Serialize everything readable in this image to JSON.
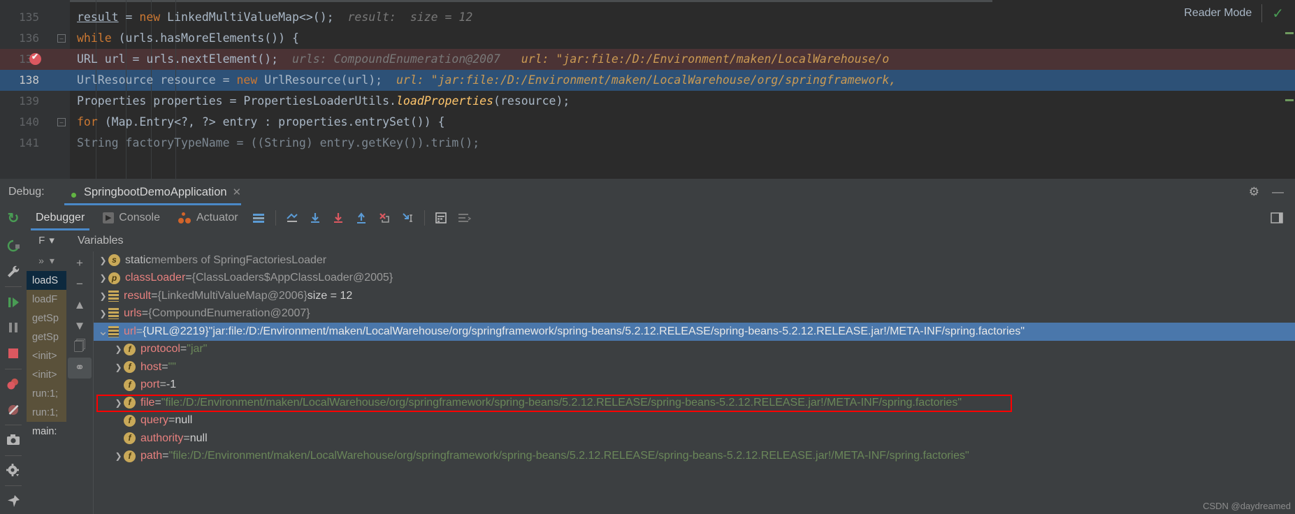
{
  "editor": {
    "reader_mode_label": "Reader Mode",
    "reader_mode_icon": "checkmark-icon",
    "lines": [
      {
        "number": "135",
        "code": "        result = new LinkedMultiValueMap<>();",
        "hint": "result:  size = 12"
      },
      {
        "number": "136",
        "code": "        while (urls.hasMoreElements()) {",
        "hint": ""
      },
      {
        "number": "137",
        "code": "            URL url = urls.nextElement();",
        "hint": "urls: CompoundEnumeration@2007",
        "hint2": "url: \"jar:file:/D:/Environment/maken/LocalWarehouse/o"
      },
      {
        "number": "138",
        "code": "            UrlResource resource = new UrlResource(url);",
        "hint": "url: \"jar:file:/D:/Environment/maken/LocalWarehouse/org/springframework,"
      },
      {
        "number": "139",
        "code": "            Properties properties = PropertiesLoaderUtils.loadProperties(resource);",
        "hint": ""
      },
      {
        "number": "140",
        "code": "            for (Map.Entry<?, ?> entry : properties.entrySet()) {",
        "hint": ""
      },
      {
        "number": "141",
        "code": "                String factoryTypeName = ((String) entry.getKey()).trim();",
        "hint": ""
      }
    ]
  },
  "debug_header": {
    "label": "Debug:",
    "run_config_name": "SpringbootDemoApplication",
    "run_config_icon": "spring-leaf-icon",
    "close_icon": "close-icon",
    "settings_icon": "gear-icon",
    "minimize_icon": "minimize-icon"
  },
  "debug_toolbar": {
    "rerun_icon": "rerun-icon",
    "tabs": [
      {
        "label": "Debugger",
        "icon": "",
        "active": true
      },
      {
        "label": "Console",
        "icon": "console-icon",
        "active": false
      },
      {
        "label": "Actuator",
        "icon": "actuator-icon",
        "active": false
      }
    ],
    "buttons": [
      "layout-settings-icon",
      "show-execution-point-icon",
      "step-over-icon",
      "step-into-icon",
      "step-out-icon",
      "force-step-into-icon",
      "run-to-cursor-icon",
      "evaluate-expression-icon",
      "mute-breakpoints-icon",
      "restore-layout-icon"
    ]
  },
  "left_rail": {
    "buttons": [
      "rerun-debug-icon",
      "settings-wrench-icon",
      "resume-program-icon",
      "pause-program-icon",
      "stop-icon",
      "view-breakpoints-icon",
      "mute-breakpoints-icon",
      "screenshot-icon",
      "settings-gear-icon",
      "pin-icon"
    ]
  },
  "frames": {
    "header_label": "F",
    "header_chevron": "chevron-down-icon",
    "overflow_icon": "double-chevron-icon",
    "thread_chevron": "chevron-down-icon",
    "items": [
      {
        "label": "loadS",
        "state": "selected"
      },
      {
        "label": "loadF",
        "state": "library"
      },
      {
        "label": "getSp",
        "state": "library"
      },
      {
        "label": "getSp",
        "state": "library"
      },
      {
        "label": "<init>",
        "state": "library"
      },
      {
        "label": "<init>",
        "state": "library"
      },
      {
        "label": "run:1;",
        "state": "library"
      },
      {
        "label": "run:1;",
        "state": "library"
      },
      {
        "label": "main:",
        "state": "plain"
      }
    ]
  },
  "variables": {
    "title": "Variables",
    "tool_buttons": [
      "add-watch-icon",
      "remove-watch-icon",
      "move-up-icon",
      "move-down-icon",
      "copy-value-icon",
      "inspect-icon"
    ],
    "rows": [
      {
        "indent": 0,
        "arrow": "right",
        "badge": "s",
        "badge_kind": "static",
        "name": "static",
        "sep": "",
        "value": " members of SpringFactoriesLoader",
        "value_kind": "dim",
        "selected": false
      },
      {
        "indent": 0,
        "arrow": "right",
        "badge": "p",
        "badge_kind": "field",
        "name": "classLoader",
        "sep": " = ",
        "value": "{ClassLoaders$AppClassLoader@2005}",
        "value_kind": "ref",
        "selected": false
      },
      {
        "indent": 0,
        "arrow": "right",
        "badge": "map",
        "badge_kind": "map",
        "name": "result",
        "sep": " = ",
        "value": "{LinkedMultiValueMap@2006}",
        "extra": "  size = 12",
        "value_kind": "ref",
        "selected": false
      },
      {
        "indent": 0,
        "arrow": "right",
        "badge": "map",
        "badge_kind": "map",
        "name": "urls",
        "sep": " = ",
        "value": "{CompoundEnumeration@2007}",
        "value_kind": "ref",
        "selected": false
      },
      {
        "indent": 0,
        "arrow": "down",
        "badge": "map",
        "badge_kind": "map",
        "name": "url",
        "sep": " = ",
        "value": "{URL@2219}",
        "extra": " \"jar:file:/D:/Environment/maken/LocalWarehouse/org/springframework/spring-beans/5.2.12.RELEASE/spring-beans-5.2.12.RELEASE.jar!/META-INF/spring.factories\"",
        "value_kind": "ref",
        "selected": true
      },
      {
        "indent": 1,
        "arrow": "right",
        "badge": "f",
        "badge_kind": "field",
        "name": "protocol",
        "sep": " = ",
        "value": "\"jar\"",
        "value_kind": "string",
        "selected": false
      },
      {
        "indent": 1,
        "arrow": "right",
        "badge": "f",
        "badge_kind": "field",
        "name": "host",
        "sep": " = ",
        "value": "\"\"",
        "value_kind": "string",
        "selected": false
      },
      {
        "indent": 1,
        "arrow": "none",
        "badge": "f",
        "badge_kind": "field",
        "name": "port",
        "sep": " = ",
        "value": "-1",
        "value_kind": "number",
        "selected": false
      },
      {
        "indent": 1,
        "arrow": "right",
        "badge": "f",
        "badge_kind": "field",
        "name": "file",
        "sep": " = ",
        "value": "\"file:/D:/Environment/maken/LocalWarehouse/org/springframework/spring-beans/5.2.12.RELEASE/spring-beans-5.2.12.RELEASE.jar!/META-INF/spring.factories\"",
        "value_kind": "string",
        "selected": false,
        "highlighted": true
      },
      {
        "indent": 1,
        "arrow": "none",
        "badge": "f",
        "badge_kind": "field",
        "name": "query",
        "sep": " = ",
        "value": "null",
        "value_kind": "null",
        "selected": false
      },
      {
        "indent": 1,
        "arrow": "none",
        "badge": "f",
        "badge_kind": "field",
        "name": "authority",
        "sep": " = ",
        "value": "null",
        "value_kind": "null",
        "selected": false
      },
      {
        "indent": 1,
        "arrow": "right",
        "badge": "f",
        "badge_kind": "field",
        "name": "path",
        "sep": " = ",
        "value": "\"file:/D:/Environment/maken/LocalWarehouse/org/springframework/spring-beans/5.2.12.RELEASE/spring-beans-5.2.12.RELEASE.jar!/META-INF/spring.factories\"",
        "value_kind": "string",
        "selected": false
      }
    ]
  },
  "watermark": "CSDN @daydreamed",
  "colors": {
    "editor_bg": "#2b2b2b",
    "panel_bg": "#3c3f41",
    "selection_blue": "#4a77ab",
    "current_line_blue": "#2d5177",
    "breakpoint_line": "#4b3335",
    "accent_tab": "#4a88c7",
    "string_green": "#6a8759",
    "name_red": "#e8817f",
    "highlight_box_red": "#ff0000",
    "keyword_orange": "#cc7832"
  }
}
